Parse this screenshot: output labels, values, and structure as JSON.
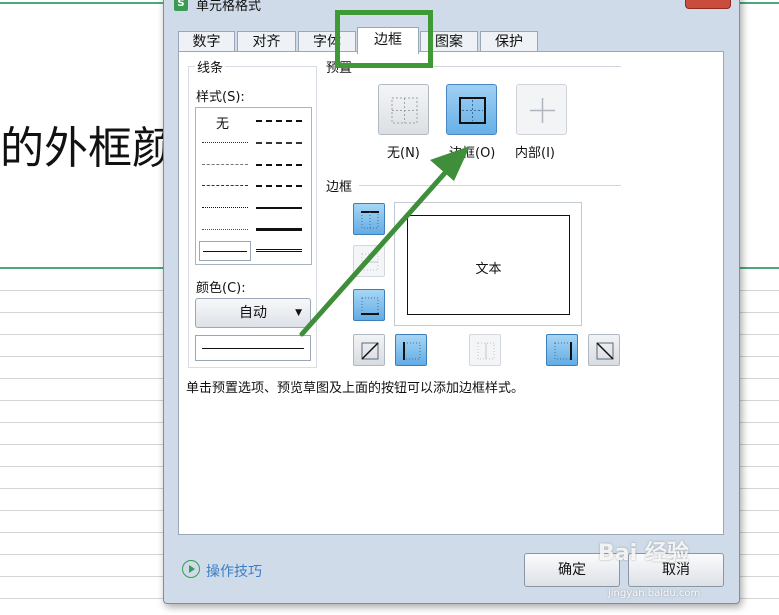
{
  "background": {
    "doc_text": "的外框颜"
  },
  "dialog": {
    "title": "单元格格式",
    "tabs": [
      {
        "label": "数字",
        "active": false
      },
      {
        "label": "对齐",
        "active": false
      },
      {
        "label": "字体",
        "active": false
      },
      {
        "label": "边框",
        "active": true
      },
      {
        "label": "图案",
        "active": false
      },
      {
        "label": "保护",
        "active": false
      }
    ],
    "line_group": {
      "title": "线条",
      "style_label": "样式(S):",
      "none_label": "无",
      "color_label": "颜色(C):",
      "color_value": "自动"
    },
    "preset_group": {
      "title": "预置",
      "items": [
        {
          "label": "无(N)",
          "icon": "preset-none-icon",
          "selected": false,
          "enabled": true
        },
        {
          "label": "边框(O)",
          "icon": "preset-outline-icon",
          "selected": true,
          "enabled": true
        },
        {
          "label": "内部(I)",
          "icon": "preset-inside-icon",
          "selected": false,
          "enabled": false
        }
      ]
    },
    "border_group": {
      "title": "边框",
      "preview_text": "文本"
    },
    "hint": "单击预置选项、预览草图及上面的按钮可以添加边框样式。",
    "tips_label": "操作技巧",
    "ok_label": "确定",
    "cancel_label": "取消"
  },
  "annotation": {
    "highlight_color": "#3f9a36",
    "arrow_color": "#3f8f3a"
  },
  "watermark": {
    "text": "Bai 经验",
    "sub": "jingyan.baidu.com"
  }
}
